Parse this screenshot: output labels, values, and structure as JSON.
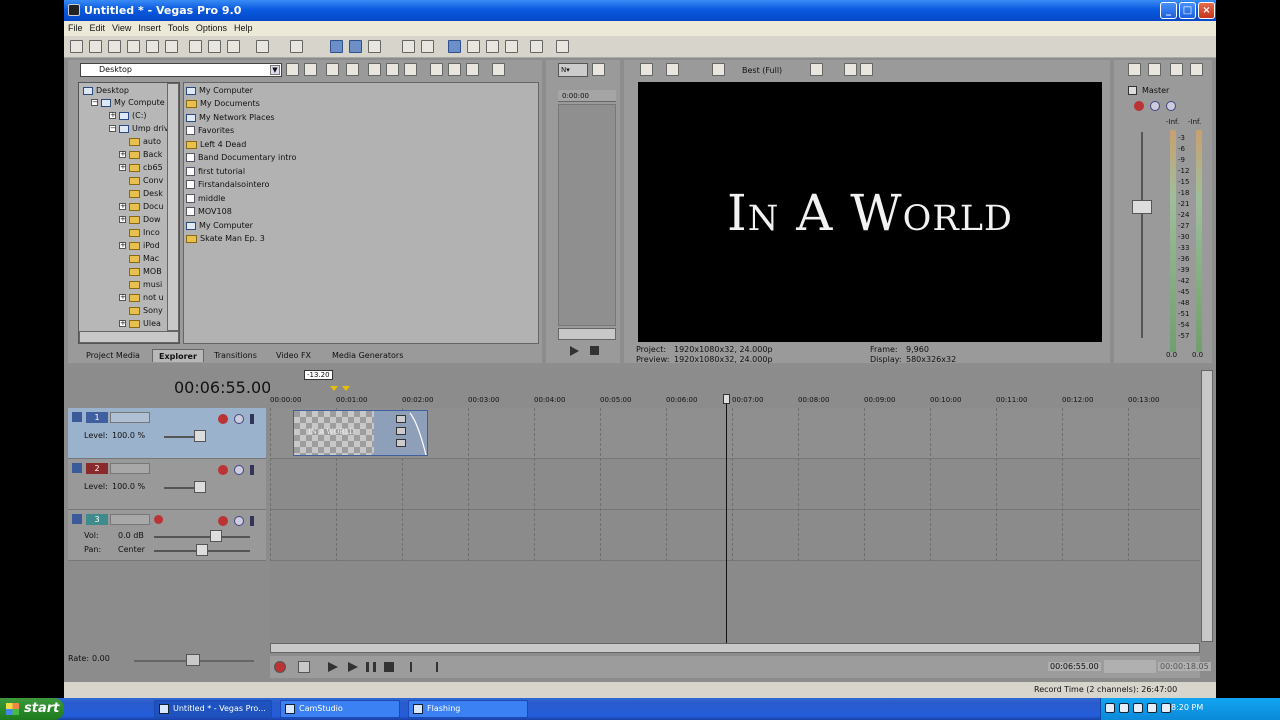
{
  "window": {
    "title": "Untitled * - Vegas Pro 9.0",
    "minimize": "_",
    "maximize": "□",
    "close": "×"
  },
  "menu": [
    "File",
    "Edit",
    "View",
    "Insert",
    "Tools",
    "Options",
    "Help"
  ],
  "explorer": {
    "location": "Desktop",
    "tree": [
      "Desktop",
      "My Compute",
      "(C:)",
      "Ump driv",
      "auto",
      "Back",
      "cb65",
      "Conv",
      "Desk",
      "Docu",
      "Dow",
      "Inco",
      "iPod",
      "Mac",
      "MOB",
      "musi",
      "not u",
      "Sony",
      "Ulea"
    ],
    "files": [
      "My Computer",
      "My Documents",
      "My Network Places",
      "Favorites",
      "Left 4 Dead",
      "Band Documentary intro",
      "first tutorial",
      "Firstandalsointero",
      "middle",
      "MOV108",
      "My Computer",
      "Skate Man Ep. 3"
    ]
  },
  "tabs": [
    "Project Media",
    "Explorer",
    "Transitions",
    "Video FX",
    "Media Generators"
  ],
  "trimmer": {
    "time": "0:00:00"
  },
  "preview": {
    "quality": "Best (Full)",
    "text": "In A World",
    "project_label": "Project:",
    "project_value": "1920x1080x32, 24.000p",
    "preview_label": "Preview:",
    "preview_value": "1920x1080x32, 24.000p",
    "frame_label": "Frame:",
    "frame_value": "9,960",
    "display_label": "Display:",
    "display_value": "580x326x32"
  },
  "mixer": {
    "title": "Master",
    "peak_left": "-Inf.",
    "peak_right": "-Inf.",
    "scale": [
      "3",
      "6",
      "9",
      "12",
      "15",
      "18",
      "21",
      "24",
      "27",
      "30",
      "33",
      "36",
      "39",
      "42",
      "45",
      "48",
      "51",
      "54",
      "57"
    ],
    "bottom_left": "0.0",
    "bottom_right": "0.0"
  },
  "timeline": {
    "timecode": "00:06:55.00",
    "marker": "-13.20",
    "ruler": [
      "00:00:00",
      "00:01:00",
      "00:02:00",
      "00:03:00",
      "00:04:00",
      "00:05:00",
      "00:06:00",
      "00:07:00",
      "00:08:00",
      "00:09:00",
      "00:10:00",
      "00:11:00",
      "00:12:00",
      "00:13:00"
    ],
    "tracks": [
      {
        "num": "1",
        "color": "#3f5f9e",
        "level_label": "Level:",
        "level_value": "100.0 %"
      },
      {
        "num": "2",
        "color": "#8a2a2a",
        "level_label": "Level:",
        "level_value": "100.0 %"
      },
      {
        "num": "3",
        "color": "#3f8a8a",
        "vol_label": "Vol:",
        "vol_value": "0.0 dB",
        "pan_label": "Pan:",
        "pan_value": "Center"
      }
    ],
    "clip_label": "IN A WORLD",
    "rate_label": "Rate:",
    "rate_value": "0.00",
    "cursor_time": "00:06:55.00",
    "end_time": "00:00:18.05"
  },
  "status": {
    "record_time": "Record Time (2 channels): 26:47:00"
  },
  "taskbar": {
    "start": "start",
    "items": [
      "Untitled * - Vegas Pro...",
      "CamStudio",
      "Flashing"
    ],
    "clock": "8:20 PM"
  }
}
